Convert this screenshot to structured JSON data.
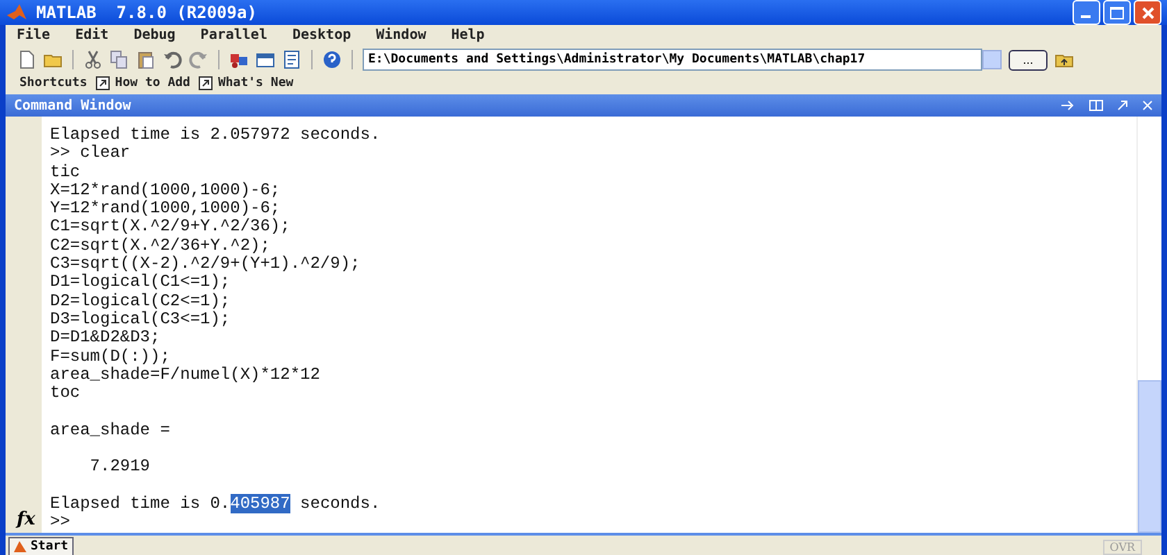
{
  "window": {
    "title": "MATLAB  7.8.0 (R2009a)"
  },
  "menu": [
    "File",
    "Edit",
    "Debug",
    "Parallel",
    "Desktop",
    "Window",
    "Help"
  ],
  "current_folder": {
    "value": "E:\\Documents and Settings\\Administrator\\My Documents\\MATLAB\\chap17",
    "browse": "..."
  },
  "shortcuts": {
    "label": "Shortcuts",
    "items": [
      "How to Add",
      "What's New"
    ]
  },
  "command_window": {
    "title": "Command Window",
    "lines": [
      {
        "kind": "code",
        "text": "Elapsed time is 2.057972 seconds."
      },
      {
        "kind": "code",
        "text": ">> clear"
      },
      {
        "kind": "code",
        "text": "tic"
      },
      {
        "kind": "code",
        "text": "X=12*rand(1000,1000)-6;"
      },
      {
        "kind": "code",
        "text": "Y=12*rand(1000,1000)-6;"
      },
      {
        "kind": "code",
        "text": "C1=sqrt(X.^2/9+Y.^2/36);"
      },
      {
        "kind": "code",
        "text": "C2=sqrt(X.^2/36+Y.^2);"
      },
      {
        "kind": "code",
        "text": "C3=sqrt((X-2).^2/9+(Y+1).^2/9);"
      },
      {
        "kind": "code",
        "text": "D1=logical(C1<=1);"
      },
      {
        "kind": "code",
        "text": "D2=logical(C2<=1);"
      },
      {
        "kind": "code",
        "text": "D3=logical(C3<=1);"
      },
      {
        "kind": "code",
        "text": "D=D1&D2&D3;"
      },
      {
        "kind": "code",
        "text": "F=sum(D(:));"
      },
      {
        "kind": "code",
        "text": "area_shade=F/numel(X)*12*12"
      },
      {
        "kind": "code",
        "text": "toc"
      },
      {
        "kind": "blank"
      },
      {
        "kind": "code",
        "text": "area_shade ="
      },
      {
        "kind": "blank"
      },
      {
        "kind": "code",
        "text": "    7.2919"
      },
      {
        "kind": "blank"
      },
      {
        "kind": "selection",
        "before": "Elapsed time is 0.",
        "selected": "405987",
        "after": " seconds."
      }
    ],
    "prompt": ">>",
    "function_hint": "fx"
  },
  "status_bar": {
    "start": "Start",
    "mode": "OVR"
  }
}
